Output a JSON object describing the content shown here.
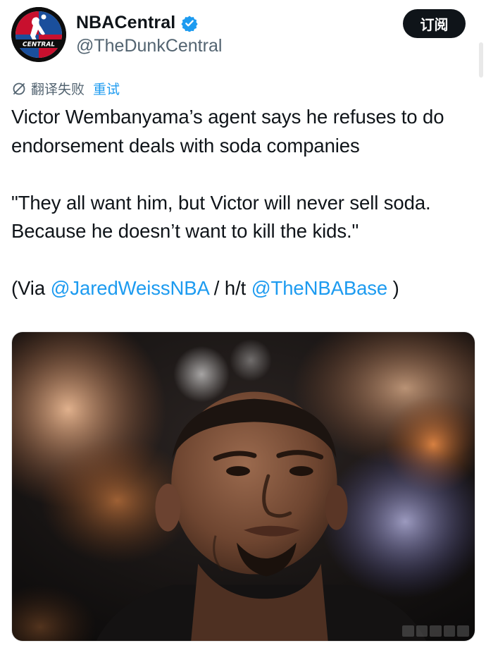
{
  "account": {
    "display_name": "NBACentral",
    "handle": "@TheDunkCentral",
    "avatar_text": "CENTRAL",
    "verified": true
  },
  "subscribe_label": "订阅",
  "translation": {
    "status": "翻译失败",
    "retry_label": "重试",
    "icon": "no-translate-icon"
  },
  "tweet": {
    "line1": "Victor Wembanyama’s agent says he refuses to do endorsement deals with soda companies",
    "quote": "\"They all want him, but Victor will never sell soda. Because he doesn’t want to kill the kids.\"",
    "via_prefix": "(Via ",
    "mention1": "@JaredWeissNBA",
    "ht": " / h/t ",
    "mention2": "@TheNBABase",
    "via_suffix": " )"
  },
  "colors": {
    "link": "#1d9bf0",
    "text": "#0f1419",
    "secondary": "#536471"
  }
}
